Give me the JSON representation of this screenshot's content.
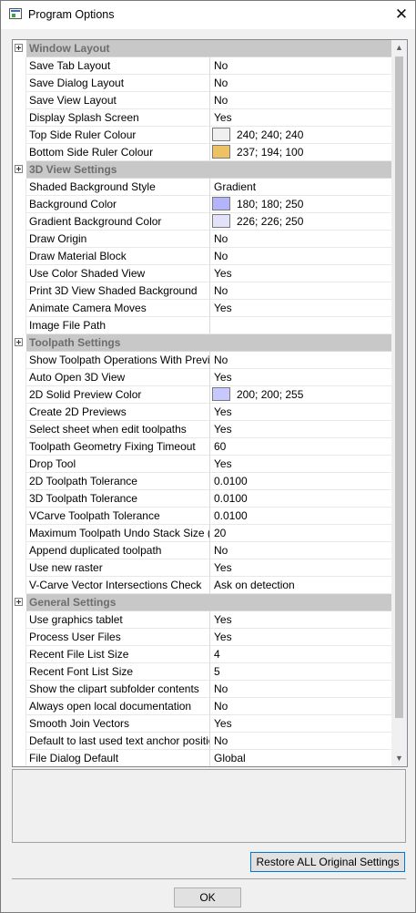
{
  "window": {
    "title": "Program Options",
    "close_glyph": "✕"
  },
  "categories": [
    {
      "label": "Window Layout",
      "props": [
        {
          "name": "Save Tab Layout",
          "value": "No"
        },
        {
          "name": "Save Dialog Layout",
          "value": "No"
        },
        {
          "name": "Save View Layout",
          "value": "No"
        },
        {
          "name": "Display Splash Screen",
          "value": "Yes"
        },
        {
          "name": "Top Side Ruler Colour",
          "value": "240; 240; 240",
          "color": "#f0f0f0"
        },
        {
          "name": "Bottom Side Ruler Colour",
          "value": "237; 194; 100",
          "color": "#edc264"
        }
      ]
    },
    {
      "label": "3D View Settings",
      "props": [
        {
          "name": "Shaded Background Style",
          "value": "Gradient"
        },
        {
          "name": "Background Color",
          "value": "180; 180; 250",
          "color": "#b4b4fa"
        },
        {
          "name": "Gradient Background Color",
          "value": "226; 226; 250",
          "color": "#e2e2fa"
        },
        {
          "name": "Draw Origin",
          "value": "No"
        },
        {
          "name": "Draw Material Block",
          "value": "No"
        },
        {
          "name": "Use Color Shaded View",
          "value": "Yes"
        },
        {
          "name": "Print 3D View Shaded Background",
          "value": "No"
        },
        {
          "name": "Animate Camera Moves",
          "value": "Yes"
        },
        {
          "name": "Image File Path",
          "value": ""
        }
      ]
    },
    {
      "label": "Toolpath Settings",
      "props": [
        {
          "name": "Show Toolpath Operations With Previe",
          "value": "No"
        },
        {
          "name": "Auto Open 3D View",
          "value": "Yes"
        },
        {
          "name": "2D Solid Preview Color",
          "value": "200; 200; 255",
          "color": "#c8c8ff"
        },
        {
          "name": "Create 2D Previews",
          "value": "Yes"
        },
        {
          "name": "Select sheet when edit toolpaths",
          "value": "Yes"
        },
        {
          "name": "Toolpath Geometry Fixing Timeout",
          "value": "60"
        },
        {
          "name": "Drop Tool",
          "value": "Yes"
        },
        {
          "name": "2D Toolpath Tolerance",
          "value": "0.0100"
        },
        {
          "name": "3D Toolpath Tolerance",
          "value": "0.0100"
        },
        {
          "name": "VCarve Toolpath Tolerance",
          "value": "0.0100"
        },
        {
          "name": "Maximum Toolpath Undo Stack Size (I",
          "value": "20"
        },
        {
          "name": "Append duplicated toolpath",
          "value": "No"
        },
        {
          "name": "Use new raster",
          "value": "Yes"
        },
        {
          "name": "V-Carve Vector Intersections Check",
          "value": "Ask on detection"
        }
      ]
    },
    {
      "label": "General Settings",
      "props": [
        {
          "name": "Use graphics tablet",
          "value": "Yes"
        },
        {
          "name": "Process User Files",
          "value": "Yes"
        },
        {
          "name": "Recent File List Size",
          "value": "4"
        },
        {
          "name": "Recent Font List Size",
          "value": "5"
        },
        {
          "name": "Show the clipart subfolder contents",
          "value": "No"
        },
        {
          "name": "Always open local documentation",
          "value": "No"
        },
        {
          "name": "Smooth Join Vectors",
          "value": "Yes"
        },
        {
          "name": "Default to last used text anchor positio",
          "value": "No"
        },
        {
          "name": "File Dialog Default",
          "value": "Global"
        }
      ]
    }
  ],
  "scrollbar": {
    "up_glyph": "▲",
    "down_glyph": "▼"
  },
  "buttons": {
    "restore_label": "Restore ALL Original Settings",
    "ok_label": "OK"
  }
}
